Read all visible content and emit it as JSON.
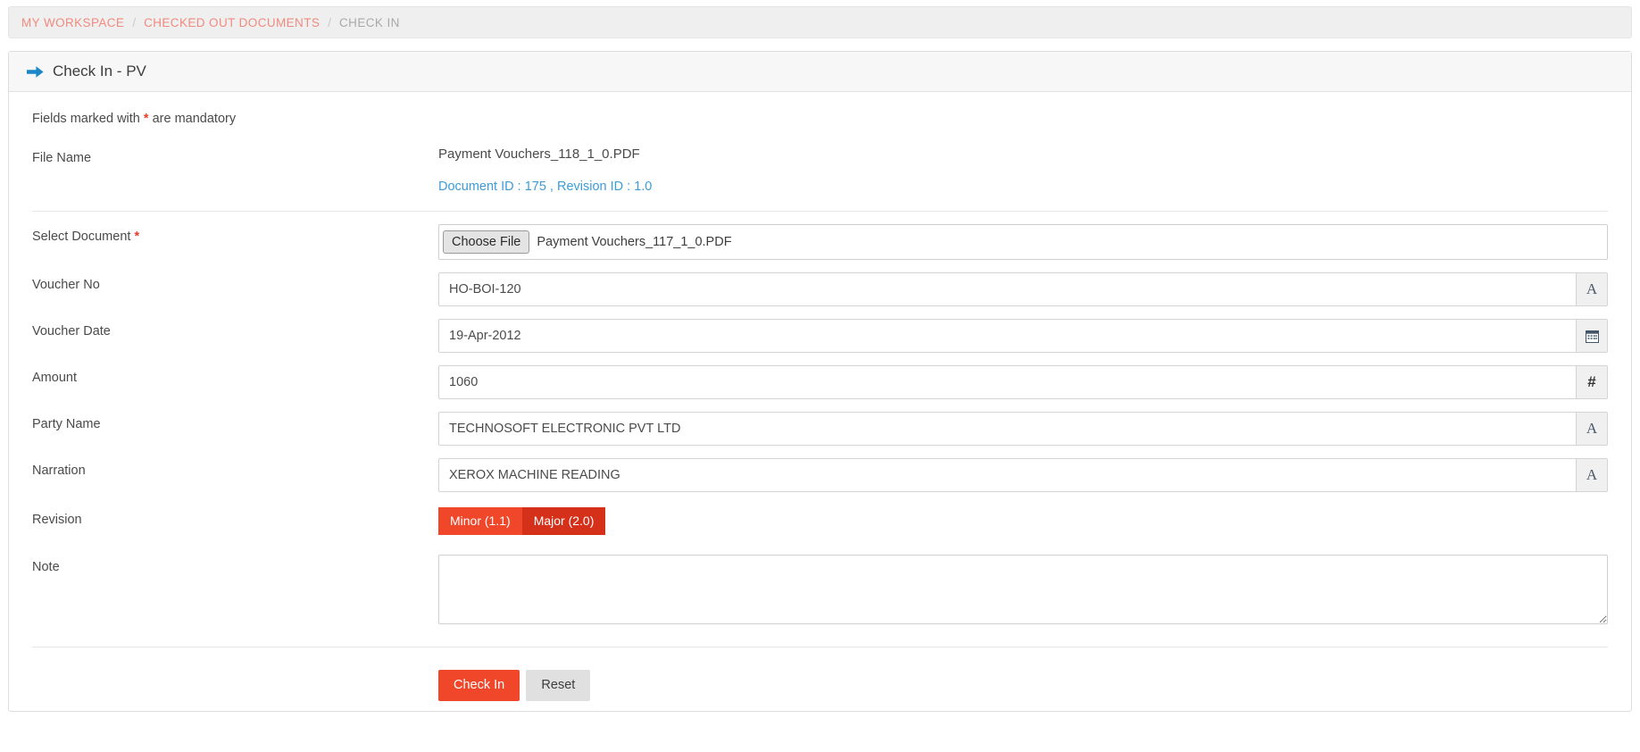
{
  "breadcrumb": {
    "items": [
      {
        "label": "MY WORKSPACE",
        "current": false
      },
      {
        "label": "CHECKED OUT DOCUMENTS",
        "current": false
      },
      {
        "label": "CHECK IN",
        "current": true
      }
    ],
    "separator": "/"
  },
  "panel": {
    "icon": "arrow-right-icon",
    "title": "Check In - PV"
  },
  "form": {
    "mandatory_note_prefix": "Fields marked with",
    "mandatory_star": "*",
    "mandatory_note_suffix": "are mandatory",
    "file_name": {
      "label": "File Name",
      "value": "Payment Vouchers_118_1_0.PDF"
    },
    "document_id": {
      "link_text": "Document ID : 175 , Revision ID : 1.0"
    },
    "select_document": {
      "label": "Select Document",
      "required_star": "*",
      "choose_button": "Choose File",
      "selected_file": "Payment Vouchers_117_1_0.PDF"
    },
    "voucher_no": {
      "label": "Voucher No",
      "value": "HO-BOI-120",
      "placeholder": "",
      "addon": "A",
      "addon_icon": "text-type-icon"
    },
    "voucher_date": {
      "label": "Voucher Date",
      "value": "19-Apr-2012",
      "placeholder": "",
      "addon": "",
      "addon_icon": "calendar-icon"
    },
    "amount": {
      "label": "Amount",
      "value": "1060",
      "placeholder": "",
      "addon": "#",
      "addon_icon": "number-type-icon"
    },
    "party_name": {
      "label": "Party Name",
      "value": "TECHNOSOFT ELECTRONIC PVT LTD",
      "placeholder": "",
      "addon": "A",
      "addon_icon": "text-type-icon"
    },
    "narration": {
      "label": "Narration",
      "value": "XEROX MACHINE READING",
      "placeholder": "",
      "addon": "A",
      "addon_icon": "text-type-icon"
    },
    "revision": {
      "label": "Revision",
      "options": [
        {
          "label": "Minor (1.1)",
          "selected": false
        },
        {
          "label": "Major (2.0)",
          "selected": true
        }
      ]
    },
    "note": {
      "label": "Note",
      "value": "",
      "placeholder": ""
    },
    "actions": {
      "submit_label": "Check In",
      "reset_label": "Reset"
    }
  },
  "colors": {
    "accent_red": "#f0462a",
    "accent_red_dark": "#d4301a",
    "breadcrumb_link": "#f08a7e",
    "breadcrumb_current": "#a9a9a9",
    "link_blue": "#3c9cd7",
    "arrow_blue": "#1b87c9"
  }
}
